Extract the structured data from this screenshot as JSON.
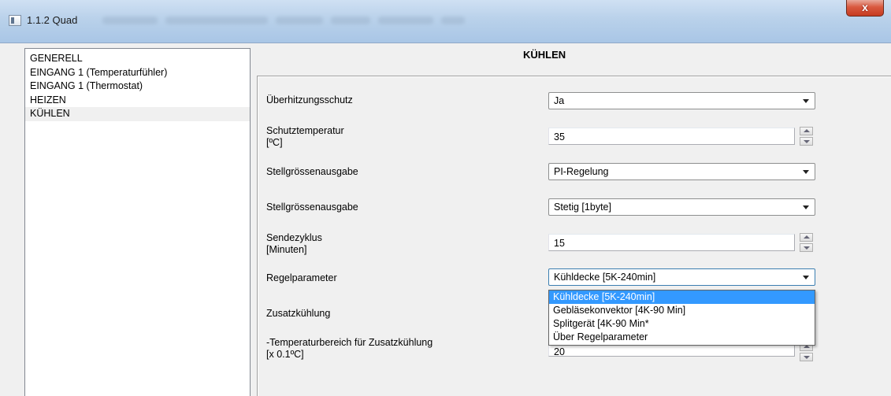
{
  "window": {
    "title": "1.1.2 Quad",
    "close_label": "x"
  },
  "nav": {
    "items": [
      {
        "label": "GENERELL"
      },
      {
        "label": "EINGANG 1 (Temperaturfühler)"
      },
      {
        "label": "EINGANG 1 (Thermostat)"
      },
      {
        "label": "HEIZEN"
      },
      {
        "label": "KÜHLEN"
      }
    ],
    "selected": "KÜHLEN"
  },
  "page": {
    "title": "KÜHLEN"
  },
  "params": {
    "overheat_label": "Überhitzungsschutz",
    "overheat_value": "Ja",
    "protect_temp_label_1": "Schutztemperatur",
    "protect_temp_label_2": "[ºC]",
    "protect_temp_value": "35",
    "control_output_label": "Stellgrössenausgabe",
    "control_output_value": "PI-Regelung",
    "control_output2_label": "Stellgrössenausgabe",
    "control_output2_value": "Stetig [1byte]",
    "send_cycle_label_1": "Sendezyklus",
    "send_cycle_label_2": "[Minuten]",
    "send_cycle_value": "15",
    "control_param_label": "Regelparameter",
    "control_param_value": "Kühldecke [5K-240min]",
    "additional_cooling_label": "Zusatzkühlung",
    "temp_range_label_1": "-Temperaturbereich für Zusatzkühlung",
    "temp_range_label_2": "[x 0.1ºC]",
    "temp_range_value": "20"
  },
  "dropdown": {
    "options": [
      "Kühldecke [5K-240min]",
      "Gebläsekonvektor [4K-90 Min]",
      "Splitgerät [4K-90 Min*",
      "Über Regelparameter"
    ],
    "highlighted": "Kühldecke [5K-240min]"
  }
}
